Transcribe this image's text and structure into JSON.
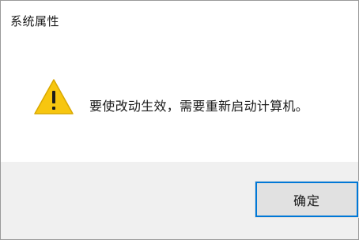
{
  "window": {
    "title": "系统属性"
  },
  "message": {
    "text": "要使改动生效，需要重新启动计算机。",
    "icon": "warning-icon"
  },
  "buttons": {
    "ok_label": "确定"
  },
  "colors": {
    "warning_fill": "#f7c60f",
    "footer_bg": "#f0f0f0",
    "button_bg": "#e1e1e1",
    "button_focus_border": "#0078d7"
  }
}
